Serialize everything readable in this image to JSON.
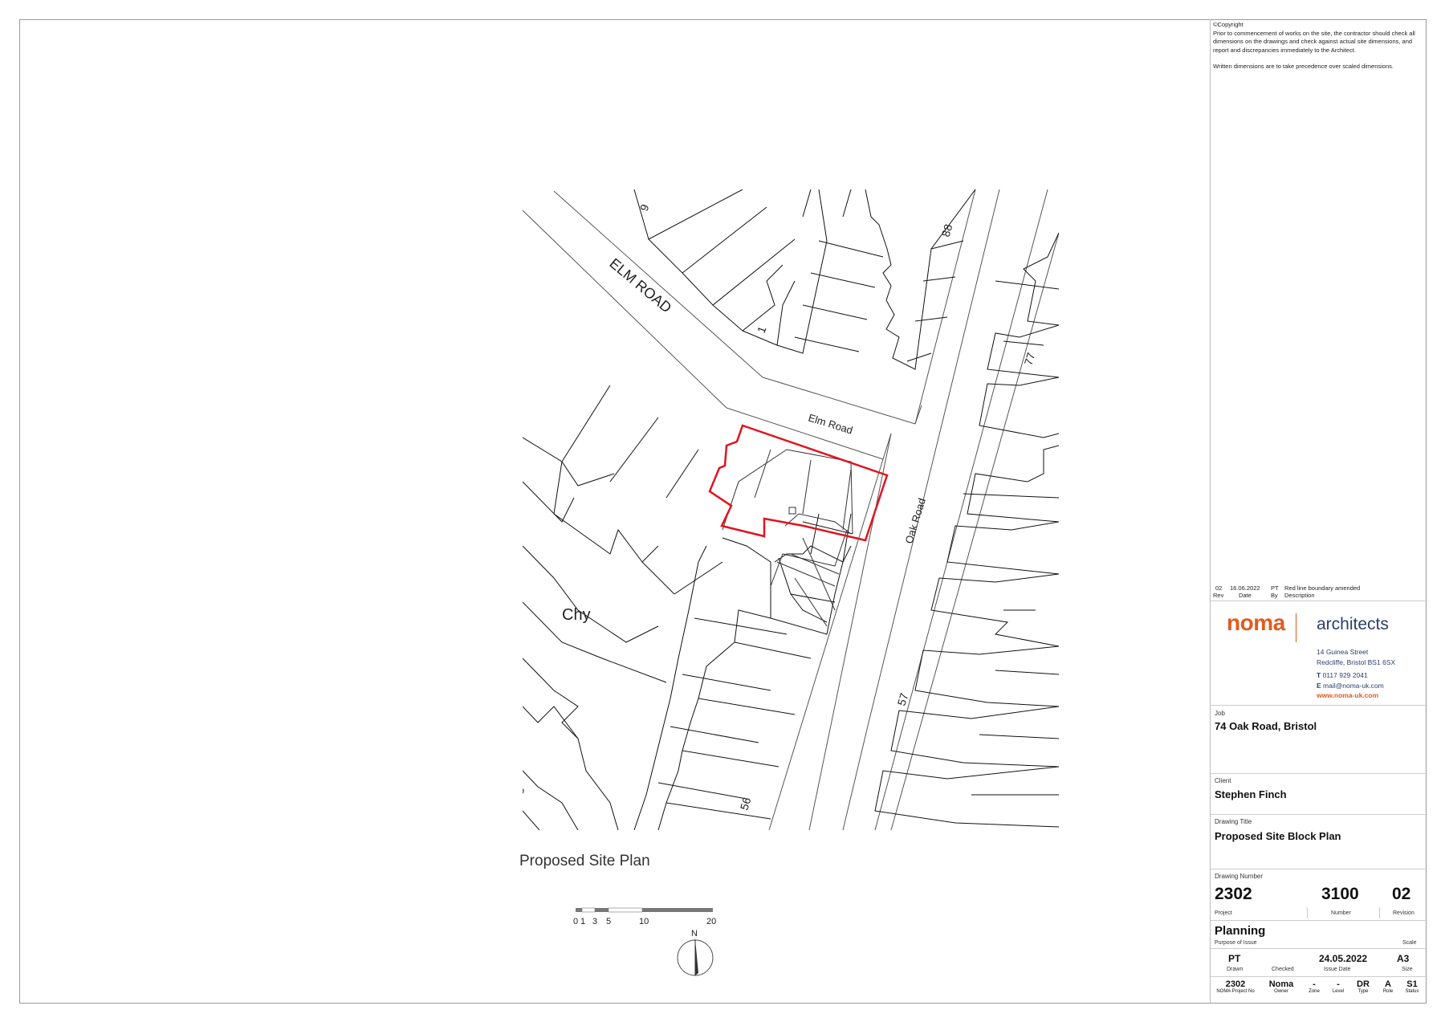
{
  "notes": {
    "copyright": "©Copyright",
    "line1": "Prior to commencement of works on the site, the contractor should check all dimensions on the drawings and check against actual site dimensions, and report and discrepancies immediately to the Architect.",
    "line2": "Written dimensions are to take precedence over scaled dimensions."
  },
  "revision": {
    "rev": "02",
    "date": "16.06.2022",
    "by": "PT",
    "description": "Red line boundary amended",
    "rev_label": "Rev",
    "date_label": "Date",
    "by_label": "By",
    "desc_label": "Description"
  },
  "company": {
    "name_a": "noma",
    "name_b": "architects",
    "street": "14 Guinea Street",
    "city": "Redcliffe, Bristol BS1 6SX",
    "tel": "0117 929 2041",
    "email": "mail@noma-uk.com",
    "web": "www.noma-uk.com",
    "tel_prefix": "T",
    "email_prefix": "E"
  },
  "job": {
    "label": "Job",
    "value": "74 Oak Road, Bristol"
  },
  "client": {
    "label": "Client",
    "value": "Stephen Finch"
  },
  "drawing_title": {
    "label": "Drawing Title",
    "value": "Proposed Site Block Plan"
  },
  "drawing_number": {
    "label": "Drawing Number",
    "project": "2302",
    "number": "3100",
    "revision": "02",
    "project_label": "Project",
    "number_label": "Number",
    "revision_label": "Revision"
  },
  "purpose": {
    "value": "Planning",
    "label": "Purpose of Issue",
    "scale_label": "Scale"
  },
  "issue": {
    "drawn": "PT",
    "drawn_label": "Drawn",
    "checked_label": "Checked",
    "date": "24.05.2022",
    "date_label": "Issue Date",
    "size": "A3",
    "size_label": "Size"
  },
  "codes": [
    {
      "value": "2302",
      "label": "NOMA Project No"
    },
    {
      "value": "Noma",
      "label": "Owner"
    },
    {
      "value": "-",
      "label": "Zone"
    },
    {
      "value": "-",
      "label": "Level"
    },
    {
      "value": "DR",
      "label": "Type"
    },
    {
      "value": "A",
      "label": "Role"
    },
    {
      "value": "S1",
      "label": "Status"
    }
  ],
  "plan": {
    "caption": "Proposed Site Plan",
    "labels": {
      "elm_road_caps": "ELM ROAD",
      "elm_road": "Elm Road",
      "oak_road": "Oak Road",
      "chy": "Chy",
      "n9": "9",
      "n88": "88",
      "n1": "1",
      "n77": "77",
      "n57": "57",
      "n56": "56",
      "n5": "5"
    },
    "scale_ticks": [
      "0",
      "1",
      "3",
      "5",
      "10",
      "20"
    ],
    "north": "N",
    "boundary_color": "#e0141e"
  }
}
